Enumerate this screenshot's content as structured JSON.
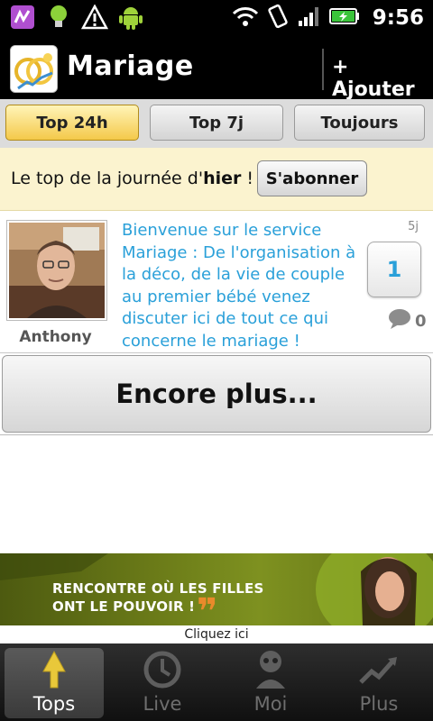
{
  "status": {
    "time": "9:56"
  },
  "app": {
    "title": "Mariage",
    "add_label": "+ Ajouter"
  },
  "tabs": [
    {
      "label": "Top 24h",
      "active": true
    },
    {
      "label": "Top 7j",
      "active": false
    },
    {
      "label": "Toujours",
      "active": false
    }
  ],
  "subheader": {
    "text_prefix": "Le top de la journée d'",
    "text_bold": "hier",
    "text_suffix": " !",
    "subscribe_label": "S'abonner"
  },
  "post": {
    "author": "Anthony",
    "text": "Bienvenue sur le service Mariage : De l'organisation à la déco, de la vie de couple au premier bébé venez discuter ici de tout ce qui concerne le mariage !",
    "age": "5j",
    "votes": "1",
    "comments": "0"
  },
  "more_label": "Encore plus...",
  "ad": {
    "line1": "RENCONTRE OÙ LES FILLES",
    "line2": "ONT LE POUVOIR !",
    "cta": "Cliquez ici"
  },
  "nav": [
    {
      "label": "Tops",
      "icon": "arrow-up-icon",
      "active": true
    },
    {
      "label": "Live",
      "icon": "clock-icon",
      "active": false
    },
    {
      "label": "Moi",
      "icon": "user-icon",
      "active": false
    },
    {
      "label": "Plus",
      "icon": "trend-icon",
      "active": false
    }
  ],
  "colors": {
    "accent": "#2aa0d9",
    "tab_active": "#f4c94a",
    "banner": "#fbf3cf"
  }
}
